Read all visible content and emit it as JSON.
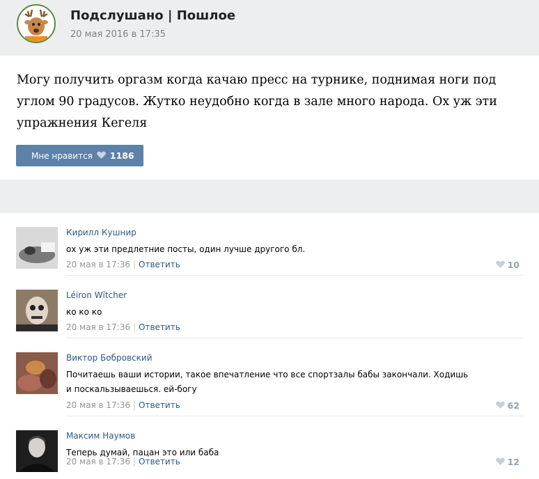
{
  "post": {
    "group_name": "Подслушано | Пошлое",
    "date": "20 мая 2016 в 17:35",
    "text": "Могу получить оргазм когда качаю пресс на турнике, поднимая ноги под углом 90 градусов. Жутко неудобно когда в зале много народа. Ох уж эти упражнения Кегеля",
    "like_label": "Мне нравится",
    "like_count": "1186"
  },
  "comments": [
    {
      "author": "Кирилл Кушнир",
      "text": "ох уж эти предлетние посты, один лучше другого бл.",
      "date": "20 мая в 17:36",
      "reply": "Ответить",
      "likes": "10"
    },
    {
      "author": "Léiron Wïtcher",
      "text": "ко ко ко",
      "date": "20 мая в 17:36",
      "reply": "Ответить",
      "likes": ""
    },
    {
      "author": "Виктор Бобровский",
      "text": "Почитаешь ваши истории, такое впечатление что все спортзалы бабы закончали. Ходишь и поскальзываешься. ей-богу",
      "date": "20 мая в 17:36",
      "reply": "Ответить",
      "likes": "62"
    },
    {
      "author": "Максим Наумов",
      "text": "Теперь думай, пацан это или баба",
      "date": "20 мая в 17:36",
      "reply": "Ответить",
      "likes": "12"
    }
  ],
  "icons": {
    "like": "heart-icon",
    "group_avatar": "deer-cartoon-avatar"
  },
  "colors": {
    "accent": "#5e81a8",
    "link": "#2a5885",
    "band": "#edeef0"
  }
}
